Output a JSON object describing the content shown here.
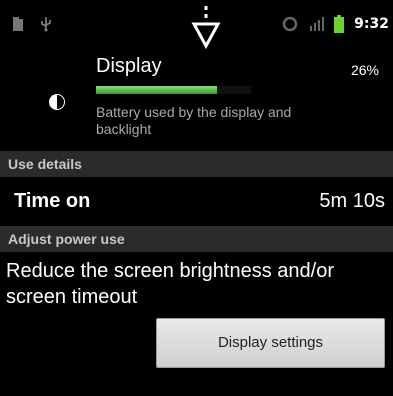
{
  "status_bar": {
    "time": "9:32",
    "icons": [
      "sd-card-icon",
      "usb-icon",
      "sync-icon",
      "signal-icon",
      "battery-icon"
    ],
    "battery_color": "#6fd32d"
  },
  "display_item": {
    "title": "Display",
    "percent": "26%",
    "progress_fraction": 0.78,
    "description": "Battery used by the display and backlight",
    "bar_color": "#4fbf3c"
  },
  "use_details": {
    "header": "Use details",
    "time_on_label": "Time on",
    "time_on_value": "5m 10s"
  },
  "adjust_power": {
    "header": "Adjust power use",
    "message": "Reduce the screen brightness and/or screen timeout",
    "button_label": "Display settings"
  }
}
